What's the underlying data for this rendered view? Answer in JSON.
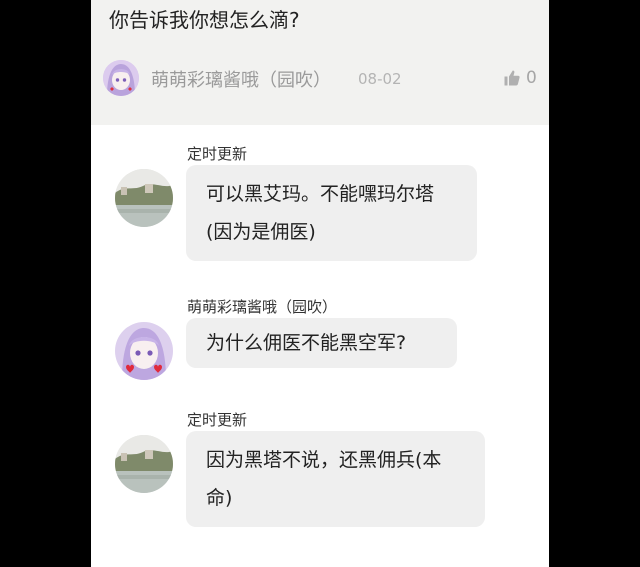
{
  "question": {
    "text": "你告诉我你想怎么滴?"
  },
  "author": {
    "name": "萌萌彩璃酱哦（园吹）",
    "date": "08-02",
    "likes": "0",
    "avatar_icon": "anime-girl-avatar"
  },
  "replies": [
    {
      "user": "定时更新",
      "text": "可以黑艾玛。不能嘿玛尔塔(因为是佣医)",
      "avatar_icon": "landscape-avatar"
    },
    {
      "user": "萌萌彩璃酱哦（园吹）",
      "text": "为什么佣医不能黑空军?",
      "avatar_icon": "anime-girl-avatar"
    },
    {
      "user": "定时更新",
      "text": "因为黑塔不说，还黑佣兵(本命)",
      "avatar_icon": "landscape-avatar"
    }
  ],
  "colors": {
    "card_bg": "#f2f2f0",
    "bubble_bg": "#efefef",
    "muted_text": "#9a9a9a"
  }
}
